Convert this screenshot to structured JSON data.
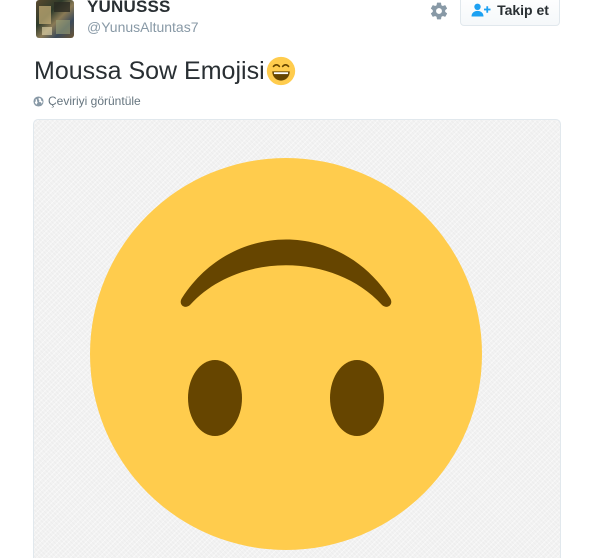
{
  "user": {
    "display_name": "YUNUSSS",
    "handle": "@YunusAltuntas7"
  },
  "actions": {
    "settings_icon": "gear-icon",
    "follow_label": "Takip et",
    "follow_icon": "add-user-icon"
  },
  "tweet": {
    "text": "Moussa Sow Emojisi",
    "trailing_emoji": "grinning-face-with-smiling-eyes",
    "translate_label": "Çeviriyi görüntüle",
    "translate_icon": "globe-icon"
  },
  "media": {
    "description_icon": "upside-down-face-emoji",
    "face_color": "#FFCC4D",
    "feature_color": "#664500"
  },
  "colors": {
    "text_primary": "#292f33",
    "text_secondary": "#8899a6",
    "border": "#e1e8ed"
  }
}
